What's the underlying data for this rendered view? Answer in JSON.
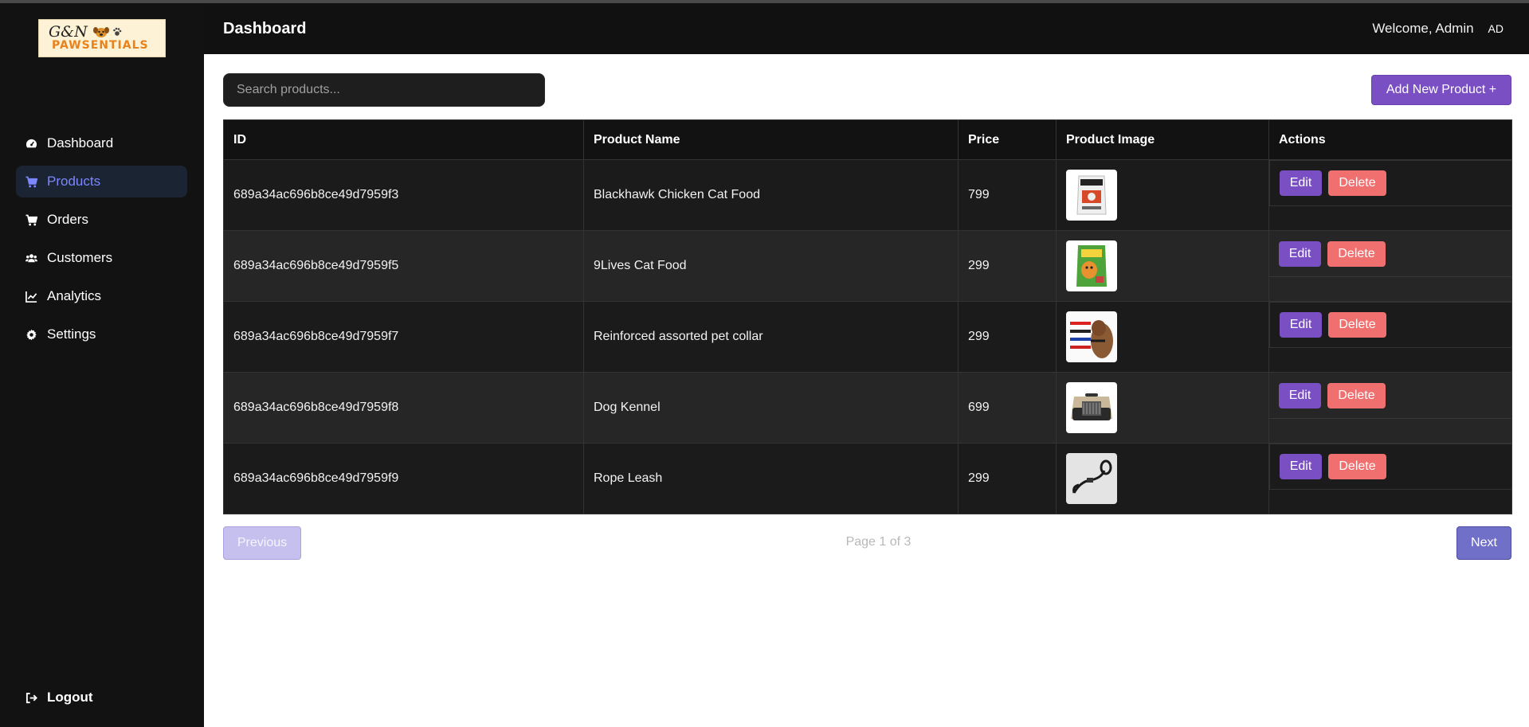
{
  "brand": {
    "line1": "G&N",
    "line2": "PAWSENTIALS"
  },
  "sidebar": {
    "items": [
      {
        "label": "Dashboard",
        "icon": "gauge-icon"
      },
      {
        "label": "Products",
        "icon": "cart-icon",
        "active": true
      },
      {
        "label": "Orders",
        "icon": "cart-icon"
      },
      {
        "label": "Customers",
        "icon": "users-icon"
      },
      {
        "label": "Analytics",
        "icon": "chart-line-icon"
      },
      {
        "label": "Settings",
        "icon": "gear-icon"
      }
    ],
    "logout": "Logout"
  },
  "header": {
    "title": "Dashboard",
    "welcome": "Welcome, Admin",
    "avatar": "AD"
  },
  "search": {
    "placeholder": "Search products...",
    "value": ""
  },
  "add_button": "Add New Product +",
  "table": {
    "columns": [
      "ID",
      "Product Name",
      "Price",
      "Product Image",
      "Actions"
    ],
    "rows": [
      {
        "id": "689a34ac696b8ce49d7959f3",
        "name": "Blackhawk Chicken Cat Food",
        "price": "799",
        "image": "cat-food-bag"
      },
      {
        "id": "689a34ac696b8ce49d7959f5",
        "name": "9Lives Cat Food",
        "price": "299",
        "image": "cat-food-bag-green"
      },
      {
        "id": "689a34ac696b8ce49d7959f7",
        "name": "Reinforced assorted pet collar",
        "price": "299",
        "image": "pet-collars"
      },
      {
        "id": "689a34ac696b8ce49d7959f8",
        "name": "Dog Kennel",
        "price": "699",
        "image": "dog-kennel"
      },
      {
        "id": "689a34ac696b8ce49d7959f9",
        "name": "Rope Leash",
        "price": "299",
        "image": "rope-leash"
      }
    ],
    "edit_label": "Edit",
    "delete_label": "Delete"
  },
  "pagination": {
    "previous": "Previous",
    "indicator": "Page 1 of 3",
    "next": "Next"
  },
  "colors": {
    "accent": "#7b4fc4",
    "danger": "#f07070",
    "active_nav": "#7b86ff",
    "sidebar_bg": "#121212"
  }
}
